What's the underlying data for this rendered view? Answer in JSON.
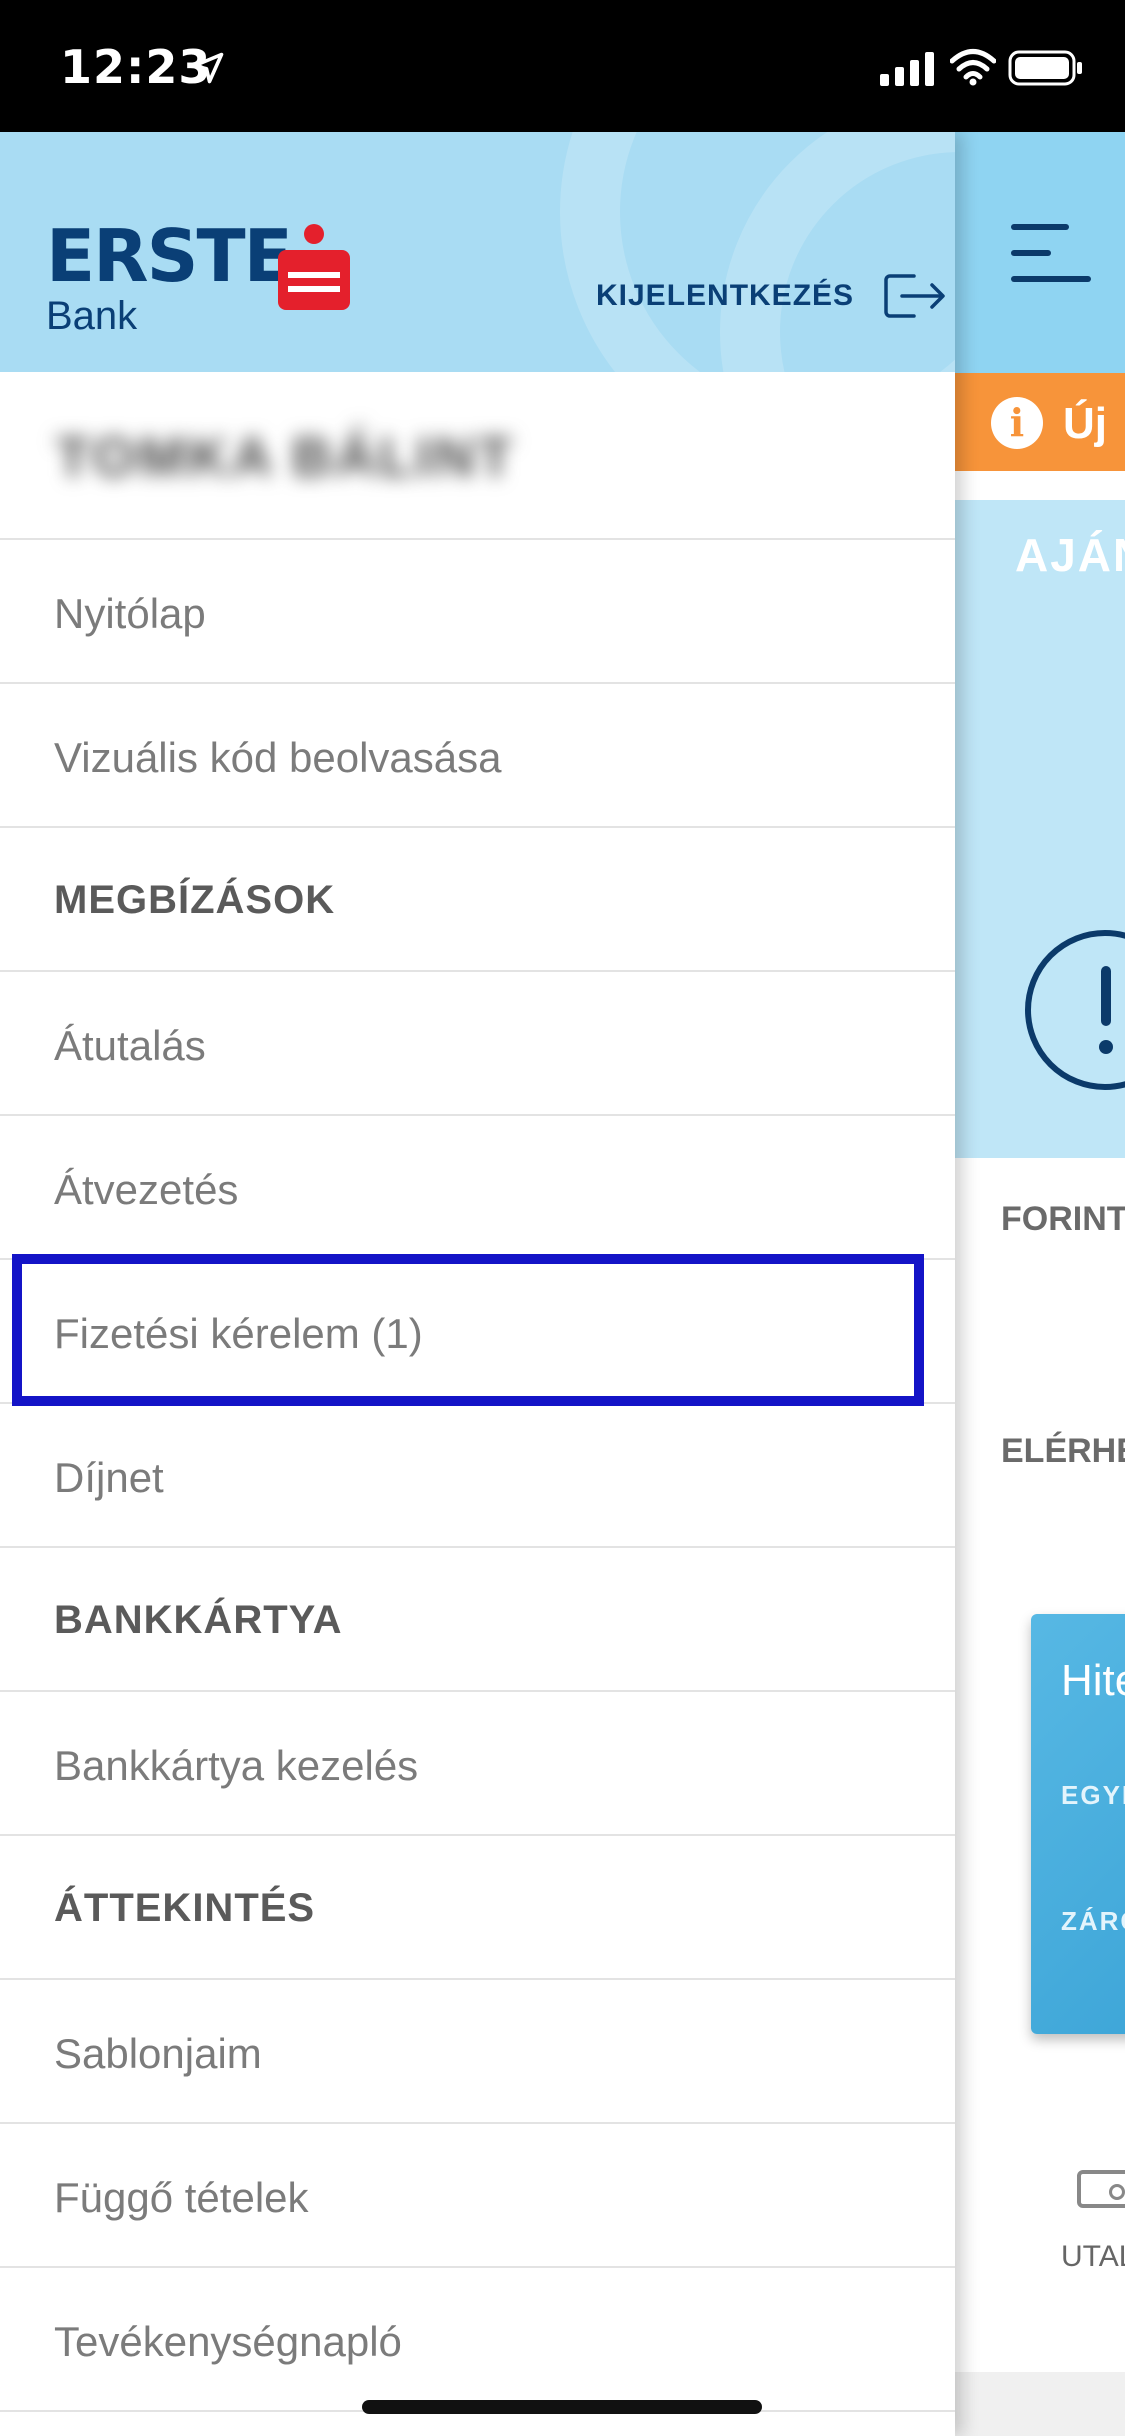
{
  "status_bar": {
    "time": "12:23"
  },
  "drawer": {
    "logo": {
      "word": "ERSTE",
      "sub": "Bank"
    },
    "logout_label": "KIJELENTKEZÉS",
    "user_name": "TOMKA BÁLINT",
    "items": [
      {
        "label": "Nyitólap",
        "type": "item"
      },
      {
        "label": "Vizuális kód beolvasása",
        "type": "item"
      },
      {
        "label": "MEGBÍZÁSOK",
        "type": "section"
      },
      {
        "label": "Átutalás",
        "type": "item"
      },
      {
        "label": "Átvezetés",
        "type": "item"
      },
      {
        "label": "Fizetési kérelem (1)",
        "type": "item"
      },
      {
        "label": "Díjnet",
        "type": "item"
      },
      {
        "label": "BANKKÁRTYA",
        "type": "section"
      },
      {
        "label": "Bankkártya kezelés",
        "type": "item"
      },
      {
        "label": "ÁTTEKINTÉS",
        "type": "section"
      },
      {
        "label": "Sablonjaim",
        "type": "item"
      },
      {
        "label": "Függő tételek",
        "type": "item"
      },
      {
        "label": "Tevékenységnapló",
        "type": "item"
      }
    ]
  },
  "main": {
    "notice_text": "Új",
    "offer_title": "AJÁN",
    "forint_label": "FORINT",
    "available_label": "ELÉRHE",
    "card_title": "Hite",
    "card_line1": "EGYE",
    "card_line2": "ZÁRÓ",
    "bottom_label": "UTAL"
  },
  "colors": {
    "header_bg": "#a9dcf3",
    "brand_blue": "#0a3f76",
    "brand_red": "#e4202c",
    "highlight": "#1414c7",
    "notice_orange": "#f7943a"
  }
}
